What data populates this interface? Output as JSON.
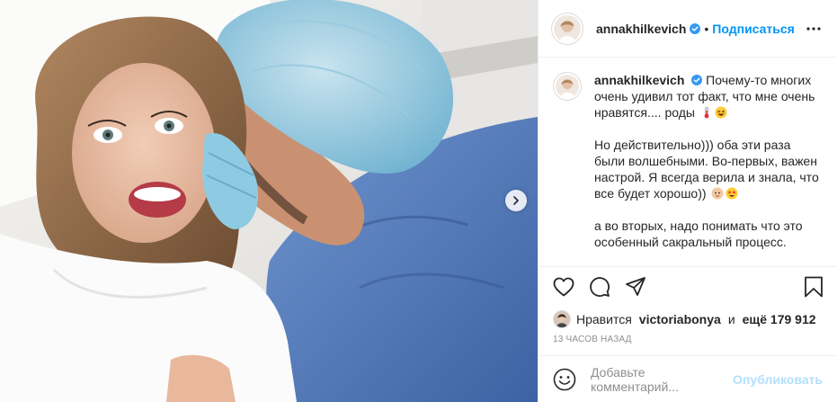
{
  "header": {
    "username": "annakhilkevich",
    "separator": "•",
    "follow_label": "Подписаться"
  },
  "caption": {
    "username": "annakhilkevich",
    "paragraphs": [
      "Почему-то многих очень удивил тот факт, что мне очень нравятся.... роды",
      "Но действительно))) оба эти раза были волшебными. Во-первых, важен настрой. Я всегда верила и знала, что все будет хорошо))",
      "а во вторых, надо понимать что это особенный сакральный процесс."
    ]
  },
  "likes": {
    "prefix": "Нравится",
    "user": "victoriabonya",
    "connector": "и",
    "others": "ещё 179 912"
  },
  "timestamp": "13 часов назад",
  "comment_box": {
    "placeholder": "Добавьте комментарий...",
    "publish_label": "Опубликовать"
  },
  "colors": {
    "accent": "#0095f6",
    "publish_disabled": "#b2dffc",
    "muted": "#8e8e8e",
    "border": "#efefef"
  },
  "icons": [
    "heart-icon",
    "comment-icon",
    "share-icon",
    "bookmark-icon",
    "more-icon",
    "verified-icon",
    "smile-icon",
    "chevron-right-icon"
  ]
}
